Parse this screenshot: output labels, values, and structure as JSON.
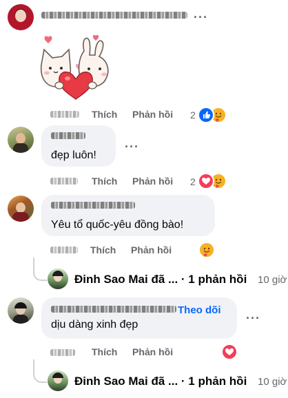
{
  "actions": {
    "like": "Thích",
    "reply": "Phản hồi"
  },
  "comments": [
    {
      "type": "sticker",
      "reaction_count": "2",
      "reactions": [
        "like-icon",
        "care-icon"
      ]
    },
    {
      "type": "text",
      "text": "đẹp luôn!",
      "reaction_count": "2",
      "reactions": [
        "love-icon",
        "care-icon"
      ]
    },
    {
      "type": "text",
      "text": "Yêu tổ quốc-yêu đồng bào!",
      "reactions": [
        "care-icon"
      ]
    },
    {
      "type": "text",
      "text": "dịu dàng xinh đẹp",
      "follow_label": "Theo dõi",
      "reactions": [
        "love-icon"
      ]
    }
  ],
  "reply_summaries": [
    {
      "text": "Đinh Sao Mai đã ... · 1 phản hồi",
      "time": "10 giờ"
    },
    {
      "text": "Đinh Sao Mai đã ... · 1 phản hồi",
      "time": "10 giờ"
    }
  ],
  "colors": {
    "like_blue": "#0866ff",
    "love_red": "#f33e58",
    "care_yellow": "#f7b125",
    "muted_gray": "#65676b",
    "bubble_bg": "#f0f2f5"
  }
}
